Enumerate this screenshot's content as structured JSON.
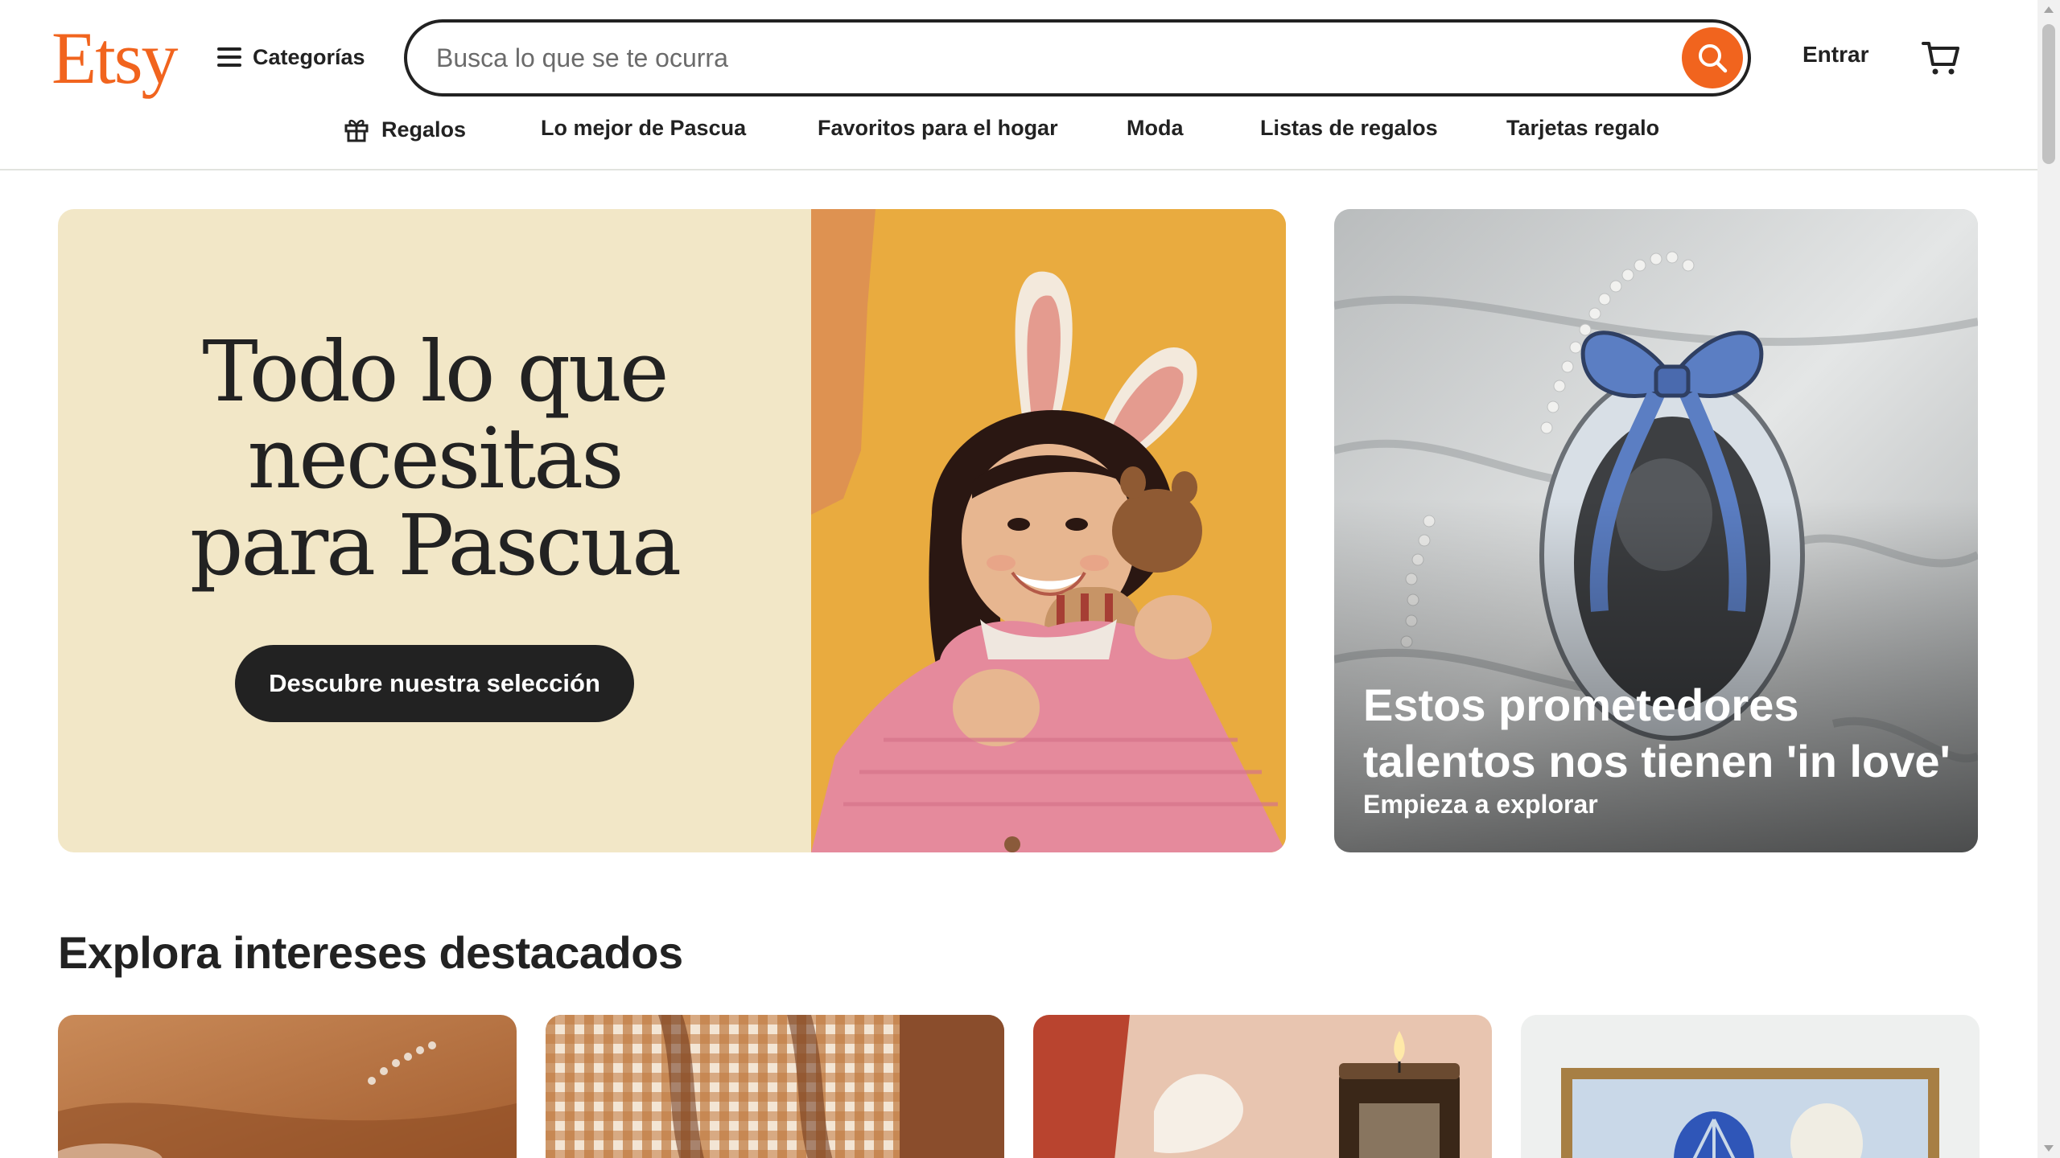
{
  "header": {
    "logo": "Etsy",
    "categories_label": "Categorías",
    "search_placeholder": "Busca lo que se te ocurra",
    "signin_label": "Entrar",
    "accent_color": "#f1641e"
  },
  "nav": {
    "items": [
      {
        "label": "Regalos",
        "icon": "gift-icon"
      },
      {
        "label": "Lo mejor de Pascua"
      },
      {
        "label": "Favoritos para el hogar"
      },
      {
        "label": "Moda"
      },
      {
        "label": "Listas de regalos"
      },
      {
        "label": "Tarjetas regalo"
      }
    ]
  },
  "hero": {
    "title_lines": [
      "Todo lo que",
      "necesitas",
      "para Pascua"
    ],
    "cta": "Descubre nuestra selección",
    "side": {
      "title": "Estos prometedores talentos nos tienen 'in love'",
      "subtitle": "Empieza a explorar"
    }
  },
  "interests": {
    "title": "Explora intereses destacados",
    "cards": [
      "card-necklace",
      "card-gingham-curtain",
      "card-candle",
      "card-framed-art"
    ]
  }
}
